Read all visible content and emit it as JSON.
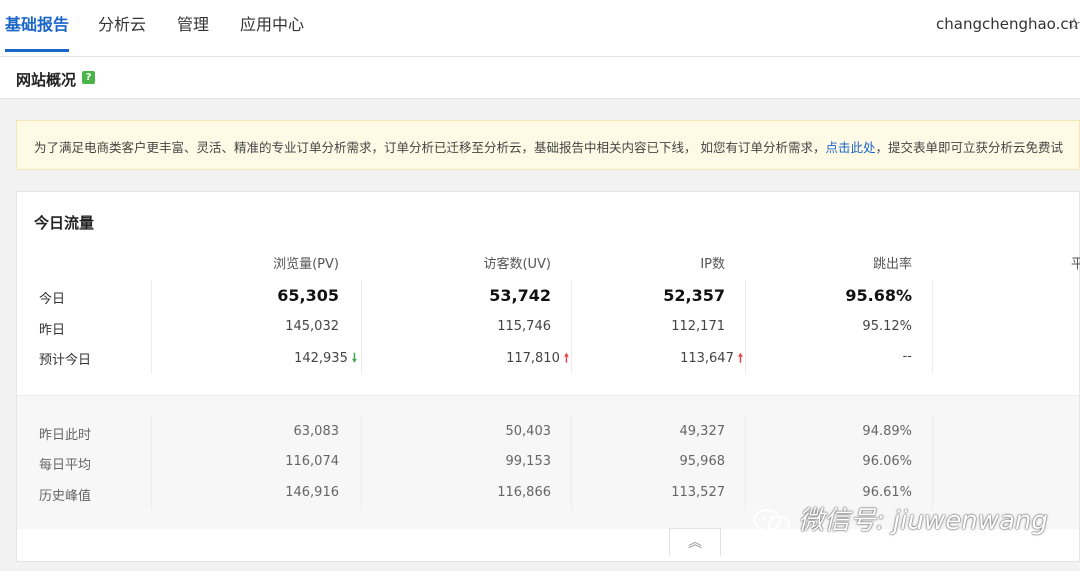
{
  "nav": {
    "tabs": [
      {
        "label": "基础报告",
        "active": true
      },
      {
        "label": "分析云",
        "active": false
      },
      {
        "label": "管理",
        "active": false
      },
      {
        "label": "应用中心",
        "active": false
      }
    ],
    "domain": "changchenghao.cn",
    "star_icon": "star-outline-icon"
  },
  "page": {
    "title": "网站概况",
    "help_glyph": "?"
  },
  "notice": {
    "text_before": "为了满足电商类客户更丰富、灵活、精准的专业订单分析需求，订单分析已迁移至分析云，基础报告中相关内容已下线， 如您有订单分析需求，",
    "link": "点击此处",
    "text_after": "，提交表单即可立获分析云免费试"
  },
  "traffic": {
    "title": "今日流量",
    "columns": [
      "浏览量(PV)",
      "访客数(UV)",
      "IP数",
      "跳出率",
      "平"
    ],
    "rows": [
      {
        "label": "今日",
        "values": [
          "65,305",
          "53,742",
          "52,357",
          "95.68%"
        ]
      },
      {
        "label": "昨日",
        "values": [
          "145,032",
          "115,746",
          "112,171",
          "95.12%"
        ]
      },
      {
        "label": "预计今日",
        "values": [
          "142,935",
          "117,810",
          "113,647",
          "--"
        ],
        "trends": [
          "down",
          "up",
          "up",
          ""
        ]
      }
    ],
    "history": [
      {
        "label": "昨日此时",
        "values": [
          "63,083",
          "50,403",
          "49,327",
          "94.89%"
        ]
      },
      {
        "label": "每日平均",
        "values": [
          "116,074",
          "99,153",
          "95,968",
          "96.06%"
        ]
      },
      {
        "label": "历史峰值",
        "values": [
          "146,916",
          "116,866",
          "113,527",
          "96.61%"
        ]
      }
    ],
    "collapse_icon": "double-chevron-up-icon"
  },
  "watermark": {
    "text": "微信号: jiuwenwang",
    "icon": "wechat-icon"
  },
  "colors": {
    "accent": "#1a66c8",
    "up": "#e84545",
    "down": "#3aa84a",
    "notice_bg": "#fffae6"
  }
}
